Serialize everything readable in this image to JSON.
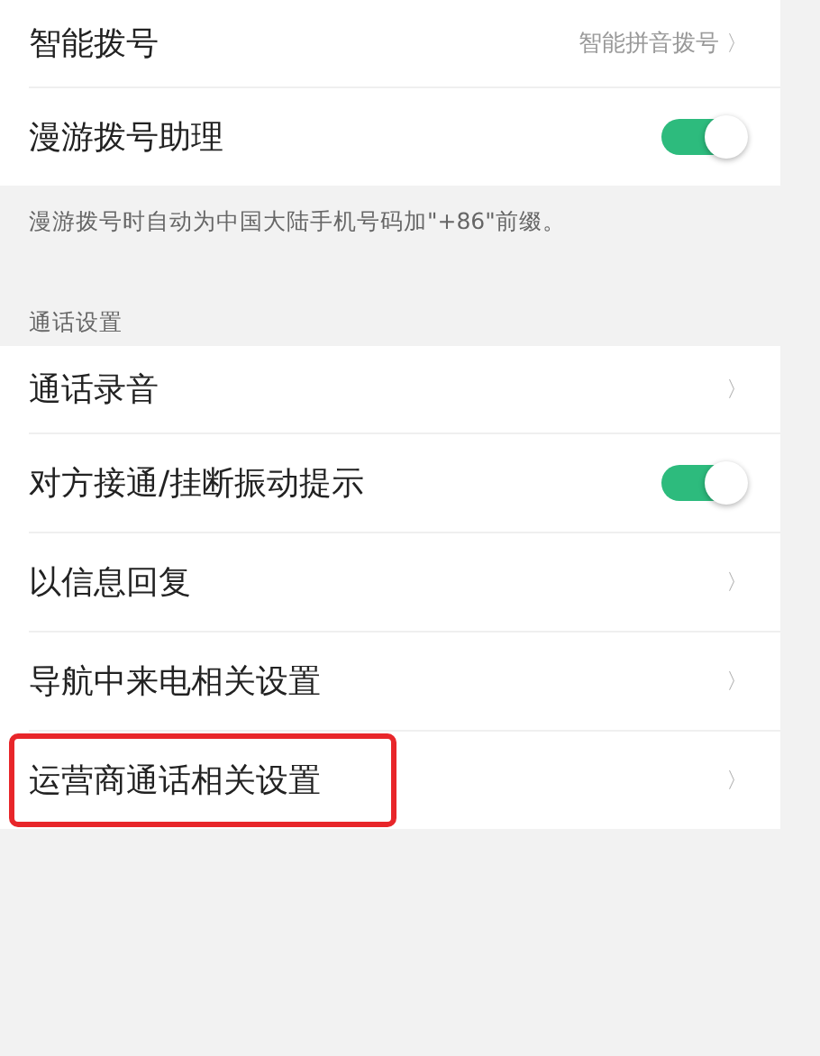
{
  "groups": [
    {
      "items": [
        {
          "kind": "link",
          "label": "智能拨号",
          "value": "智能拼音拨号",
          "chevron": "〉",
          "highlighted": false
        },
        {
          "kind": "switch",
          "label": "漫游拨号助理",
          "on": true,
          "highlighted": false
        }
      ],
      "note": "漫游拨号时自动为中国大陆手机号码加\"+86\"前缀。"
    },
    {
      "header": "通话设置",
      "items": [
        {
          "kind": "link",
          "label": "通话录音",
          "chevron": "〉",
          "highlighted": false
        },
        {
          "kind": "switch",
          "label": "对方接通/挂断振动提示",
          "on": true,
          "highlighted": false
        },
        {
          "kind": "link",
          "label": "以信息回复",
          "chevron": "〉",
          "highlighted": false
        },
        {
          "kind": "link",
          "label": "导航中来电相关设置",
          "chevron": "〉",
          "highlighted": false
        },
        {
          "kind": "link",
          "label": "运营商通话相关设置",
          "chevron": "〉",
          "highlighted": true
        }
      ]
    }
  ]
}
